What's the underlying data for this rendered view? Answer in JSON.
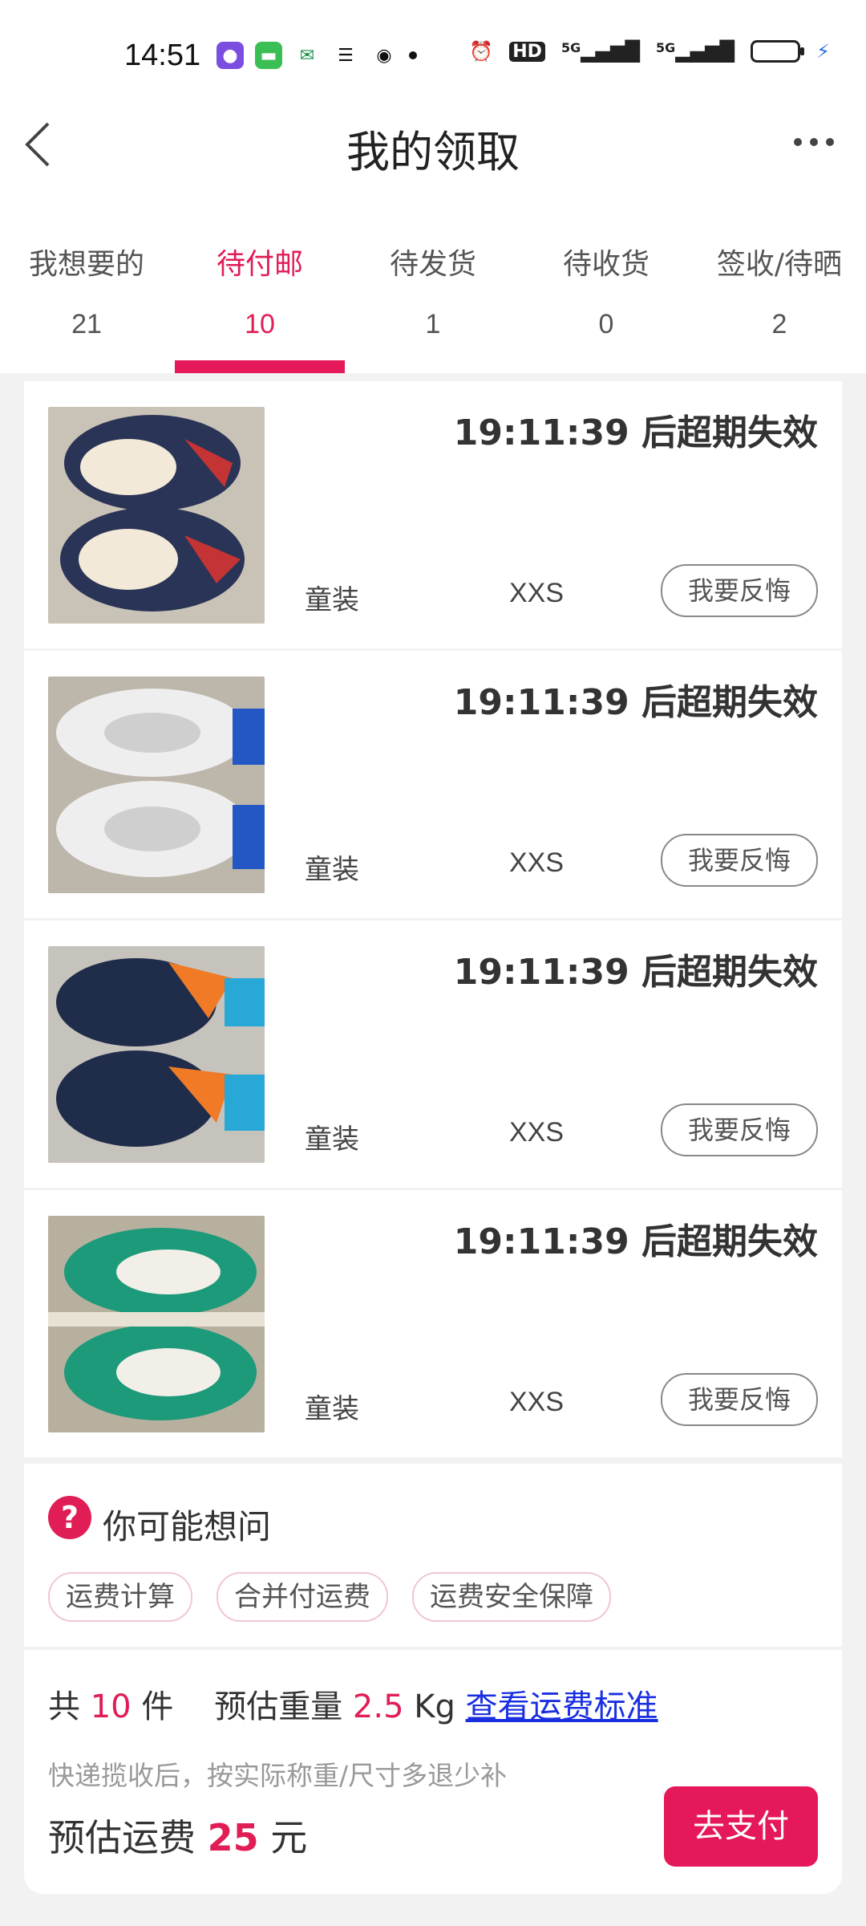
{
  "status_bar": {
    "time": "14:51",
    "hd_label": "HD",
    "net1": "5G",
    "net2": "5G"
  },
  "header": {
    "title": "我的领取"
  },
  "tabs": [
    {
      "label": "我想要的",
      "count": "21"
    },
    {
      "label": "待付邮",
      "count": "10"
    },
    {
      "label": "待发货",
      "count": "1"
    },
    {
      "label": "待收货",
      "count": "0"
    },
    {
      "label": "签收/待晒",
      "count": "2"
    }
  ],
  "active_tab": 1,
  "items": [
    {
      "timer": "19:11:39 后超期失效",
      "category": "童装",
      "size": "XXS",
      "action": "我要反悔"
    },
    {
      "timer": "19:11:39 后超期失效",
      "category": "童装",
      "size": "XXS",
      "action": "我要反悔"
    },
    {
      "timer": "19:11:39 后超期失效",
      "category": "童装",
      "size": "XXS",
      "action": "我要反悔"
    },
    {
      "timer": "19:11:39 后超期失效",
      "category": "童装",
      "size": "XXS",
      "action": "我要反悔"
    }
  ],
  "faq": {
    "title": "你可能想问",
    "chips": [
      "运费计算",
      "合并付运费",
      "运费安全保障"
    ]
  },
  "summary": {
    "total_prefix": "共",
    "total_count": "10",
    "total_unit": "件",
    "weight_label": "预估重量",
    "weight_value": "2.5",
    "weight_unit": "Kg",
    "link": "查看运费标准",
    "note": "快递揽收后，按实际称重/尺寸多退少补",
    "fee_label": "预估运费",
    "fee_value": "25",
    "fee_unit": "元",
    "pay_button": "去支付"
  },
  "colors": {
    "accent": "#e5185a",
    "link": "#1a2fe0"
  }
}
